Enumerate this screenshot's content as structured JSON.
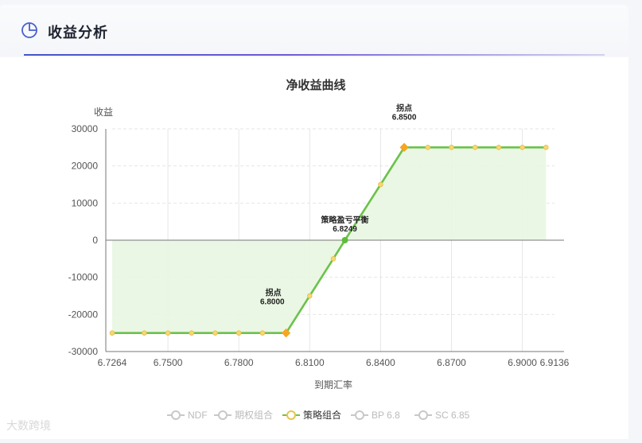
{
  "header": {
    "title": "收益分析",
    "icon": "pie-chart-icon"
  },
  "watermark": "大数跨境",
  "colors": {
    "line": "#6cc24a",
    "area": "#e8f6e1",
    "marker_fill": "#f6d77a",
    "marker_stroke": "#e9c34a",
    "kink": "#f5a623",
    "breakeven": "#5bbd3c",
    "grid": "#e6e6e6",
    "legend_off": "#c8c8c8"
  },
  "chart_data": {
    "type": "line",
    "title": "净收益曲线",
    "ylabel": "收益",
    "xlabel": "到期汇率",
    "xlim": [
      6.7264,
      6.9136
    ],
    "ylim": [
      -30000,
      30000
    ],
    "x_ticks": [
      "6.7264",
      "6.7500",
      "6.7800",
      "6.8100",
      "6.8400",
      "6.8700",
      "6.9000",
      "6.9136"
    ],
    "y_ticks": [
      "30000",
      "20000",
      "10000",
      "0",
      "-10000",
      "-20000",
      "-30000"
    ],
    "series": [
      {
        "name": "策略组合",
        "x": [
          6.7264,
          6.74,
          6.75,
          6.76,
          6.77,
          6.78,
          6.79,
          6.8,
          6.81,
          6.82,
          6.8249,
          6.84,
          6.85,
          6.86,
          6.87,
          6.88,
          6.89,
          6.9,
          6.91
        ],
        "y": [
          -25000,
          -25000,
          -25000,
          -25000,
          -25000,
          -25000,
          -25000,
          -25000,
          -15000,
          -5000,
          0,
          15000,
          25000,
          25000,
          25000,
          25000,
          25000,
          25000,
          25000
        ]
      }
    ],
    "annotations": [
      {
        "label": "拐点",
        "value": "6.8000",
        "x": 6.8,
        "y": -25000,
        "kind": "kink",
        "position": "left"
      },
      {
        "label": "策略盈亏平衡",
        "value": "6.8249",
        "x": 6.8249,
        "y": 0,
        "kind": "breakeven",
        "position": "top"
      },
      {
        "label": "拐点",
        "value": "6.8500",
        "x": 6.85,
        "y": 25000,
        "kind": "kink",
        "position": "top"
      }
    ],
    "legend": {
      "placement": "bottom",
      "items": [
        {
          "name": "NDF",
          "active": false
        },
        {
          "name": "期权组合",
          "active": false
        },
        {
          "name": "策略组合",
          "active": true
        },
        {
          "name": "BP 6.8",
          "active": false
        },
        {
          "name": "SC 6.85",
          "active": false
        }
      ]
    },
    "grid": true
  }
}
